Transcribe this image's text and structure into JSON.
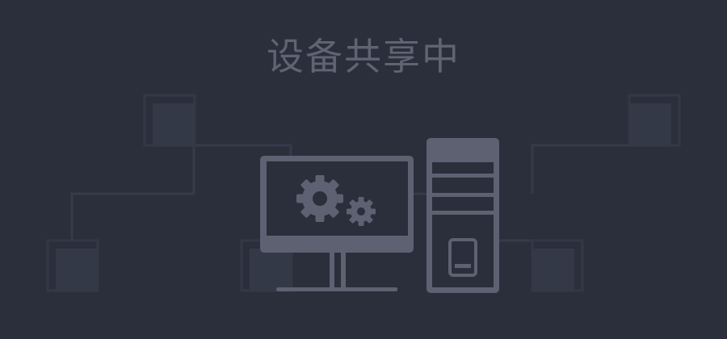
{
  "status": {
    "title": "设备共享中"
  },
  "colors": {
    "background": "#2a2f3b",
    "title_text": "#5f6373",
    "device": "#5d6171",
    "device_screen": "#2a2f3b",
    "network_line": "#353b48",
    "network_node": "#333946"
  },
  "icons": {
    "main": "computer-sharing-illustration",
    "monitor": "monitor-icon",
    "gear": "gear-icon",
    "tower": "pc-tower-icon",
    "network": "network-nodes"
  }
}
